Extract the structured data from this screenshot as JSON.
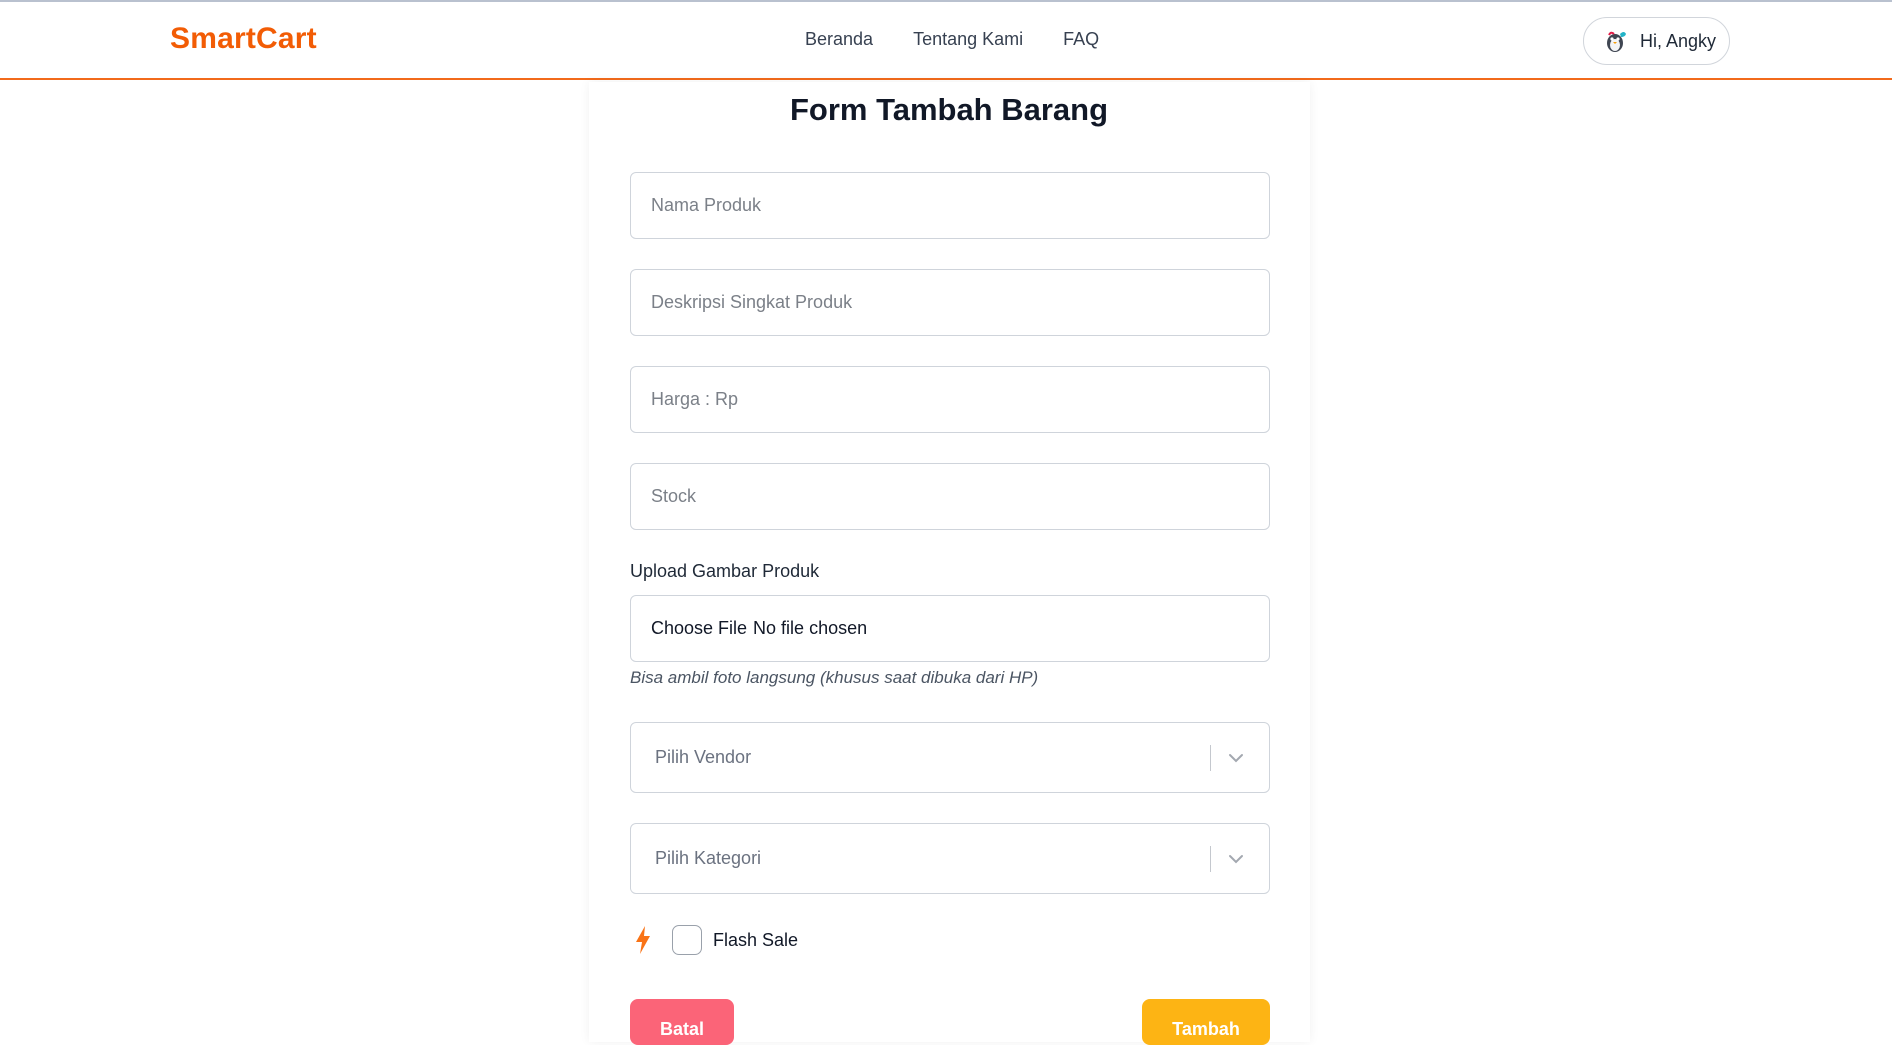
{
  "brand": {
    "name": "SmartCart",
    "color": "#f25c05"
  },
  "nav": {
    "links": [
      "Beranda",
      "Tentang Kami",
      "FAQ"
    ]
  },
  "user": {
    "greeting": "Hi, Angky",
    "avatar_icon": "user-avatar-icon"
  },
  "form": {
    "title": "Form Tambah Barang",
    "fields": {
      "nama_produk": {
        "placeholder": "Nama Produk",
        "value": ""
      },
      "deskripsi": {
        "placeholder": "Deskripsi Singkat Produk",
        "value": ""
      },
      "harga": {
        "placeholder": "Harga : Rp",
        "value": ""
      },
      "stock": {
        "placeholder": "Stock",
        "value": ""
      }
    },
    "upload": {
      "label": "Upload Gambar Produk",
      "button_label": "Choose File",
      "status": "No file chosen",
      "hint": "Bisa ambil foto langsung (khusus saat dibuka dari HP)"
    },
    "vendor_select": {
      "placeholder": "Pilih Vendor"
    },
    "kategori_select": {
      "placeholder": "Pilih Kategori"
    },
    "flash_sale": {
      "label": "Flash Sale",
      "checked": false,
      "icon": "lightning-icon"
    },
    "buttons": {
      "cancel": {
        "label": "Batal",
        "color": "#fb6478"
      },
      "submit": {
        "label": "Tambah",
        "color": "#fdb414"
      }
    }
  }
}
